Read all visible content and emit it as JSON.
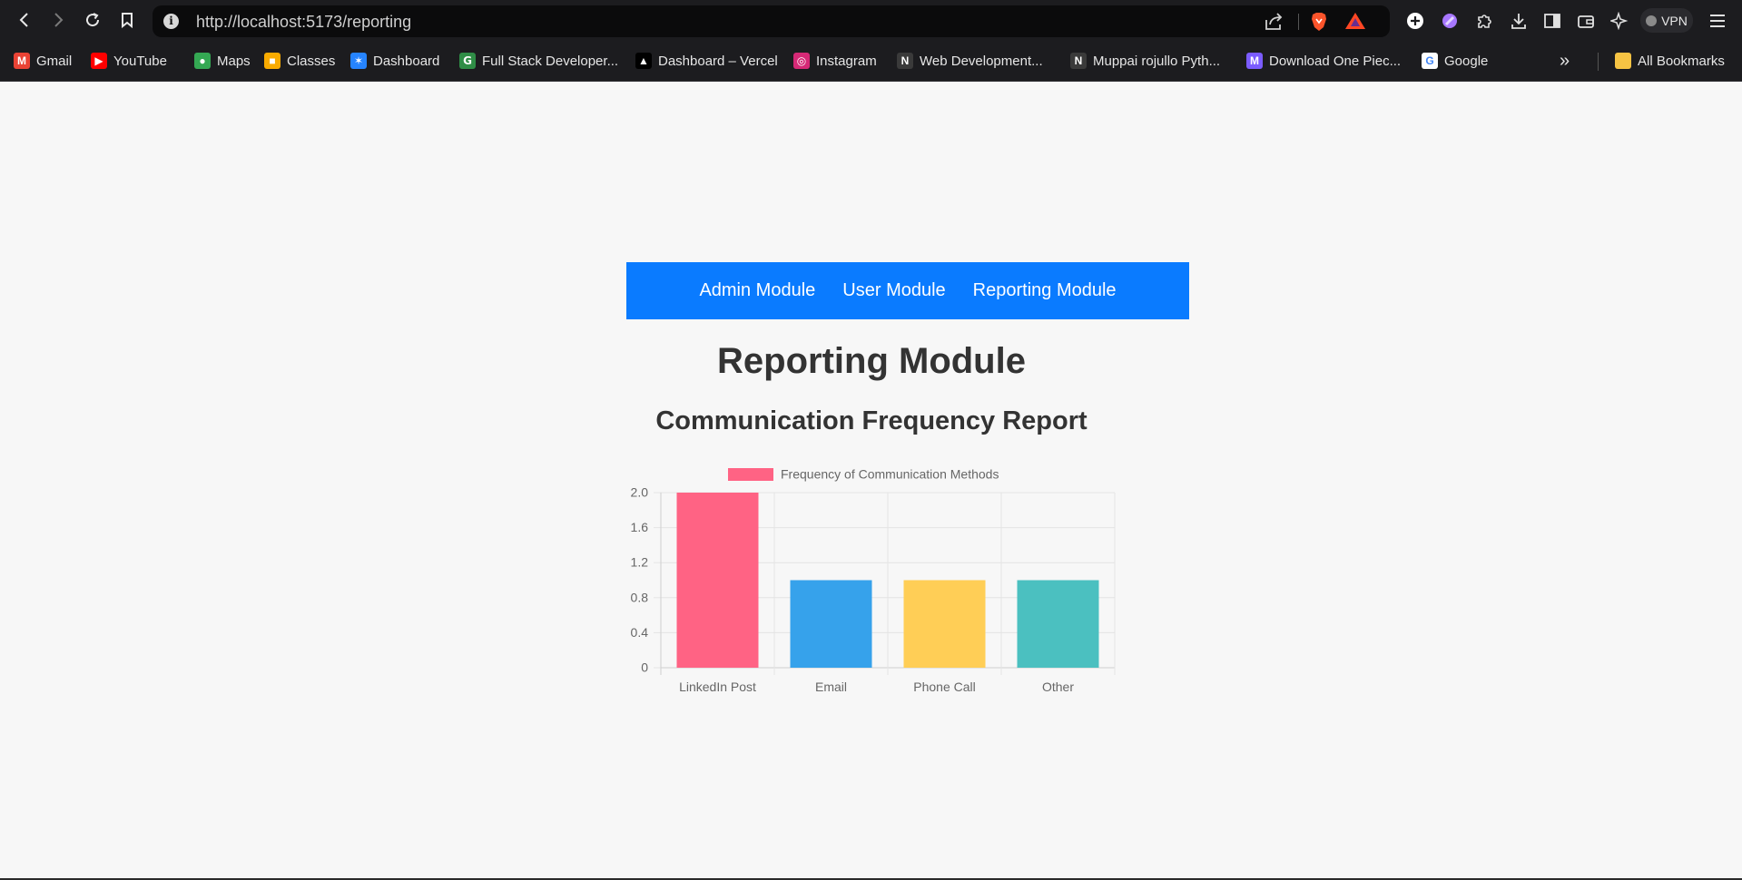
{
  "browser": {
    "url": "http://localhost:5173/reporting",
    "vpn_label": "VPN",
    "bookmarks": [
      {
        "label": "Gmail",
        "icon": "gmail-icon",
        "color": "#ea4335",
        "glyph": "M"
      },
      {
        "label": "YouTube",
        "icon": "youtube-icon",
        "color": "#ff0000",
        "glyph": "▶"
      },
      {
        "label": "Maps",
        "icon": "maps-icon",
        "color": "#34a853",
        "glyph": "●"
      },
      {
        "label": "Classes",
        "icon": "classroom-icon",
        "color": "#f9ab00",
        "glyph": "■"
      },
      {
        "label": "Dashboard",
        "icon": "dashboard-icon",
        "color": "#2684ff",
        "glyph": "✶"
      },
      {
        "label": "Full Stack Developer...",
        "icon": "gfg-icon",
        "color": "#2f8d46",
        "glyph": "ꓖ"
      },
      {
        "label": "Dashboard – Vercel",
        "icon": "vercel-icon",
        "color": "#000000",
        "glyph": "▲"
      },
      {
        "label": "Instagram",
        "icon": "instagram-icon",
        "color": "#d62976",
        "glyph": "◎"
      },
      {
        "label": "Web Development...",
        "icon": "notion-icon",
        "color": "#3a3a3a",
        "glyph": "N"
      },
      {
        "label": "Muppai rojullo Pyth...",
        "icon": "notion-icon",
        "color": "#3a3a3a",
        "glyph": "N"
      },
      {
        "label": "Download One Piec...",
        "icon": "m-logo-icon",
        "color": "#7b5cff",
        "glyph": "M"
      },
      {
        "label": "Google",
        "icon": "google-icon",
        "color": "#ffffff",
        "glyph": "G"
      }
    ],
    "all_bookmarks_label": "All Bookmarks"
  },
  "nav": {
    "items": [
      "Admin Module",
      "User Module",
      "Reporting Module"
    ]
  },
  "page": {
    "title": "Reporting Module",
    "subtitle": "Communication Frequency Report"
  },
  "chart_data": {
    "type": "bar",
    "title": "",
    "legend": "Frequency of Communication Methods",
    "legend_color": "#ff6384",
    "categories": [
      "LinkedIn Post",
      "Email",
      "Phone Call",
      "Other"
    ],
    "values": [
      2,
      1,
      1,
      1
    ],
    "colors": [
      "#ff6384",
      "#36a2eb",
      "#ffce56",
      "#4bc0c0"
    ],
    "ylim": [
      0,
      2
    ],
    "yticks": [
      "0",
      "0.4",
      "0.8",
      "1.2",
      "1.6",
      "2.0"
    ],
    "grid": true,
    "legend_position": "top"
  }
}
